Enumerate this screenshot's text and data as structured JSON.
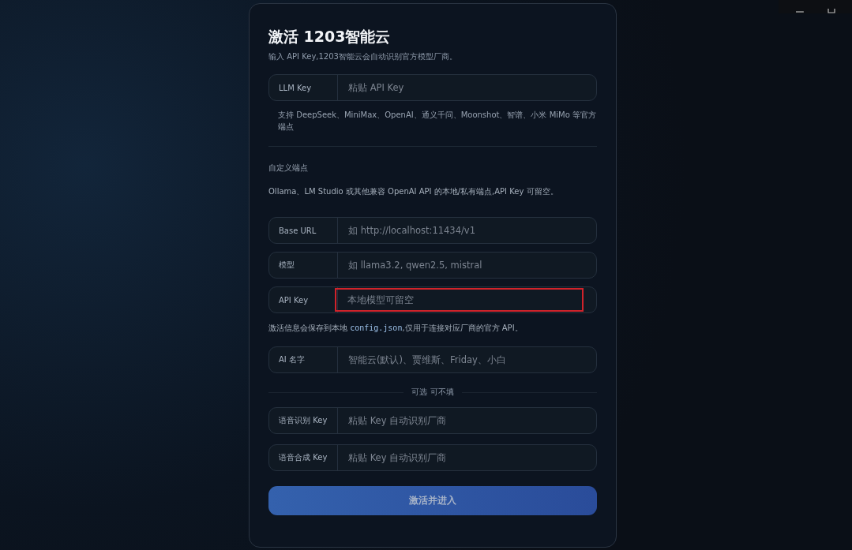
{
  "title": "激活 1203智能云",
  "subtitle": "输入 API Key,1203智能云会自动识别官方模型厂商。",
  "llm_field": {
    "label": "LLM Key",
    "placeholder": "粘贴 API Key",
    "highlighted": false
  },
  "llm_hint": "支持 DeepSeek、MiniMax、OpenAI、通义千问、Moonshot、智谱、小米 MiMo 等官方端点",
  "custom_section": {
    "heading": "自定义端点",
    "description": "Ollama、LM Studio 或其他兼容 OpenAI API 的本地/私有端点,API Key 可留空。",
    "fields": [
      {
        "label": "Base URL",
        "placeholder": "如 http://localhost:11434/v1",
        "highlighted": false
      },
      {
        "label": "模型",
        "placeholder": "如 llama3.2, qwen2.5, mistral",
        "highlighted": false
      },
      {
        "label": "API Key",
        "placeholder": "本地模型可留空",
        "highlighted": true
      }
    ]
  },
  "storage_note": {
    "before": "激活信息会保存到本地",
    "code": "config.json",
    "after": ",仅用于连接对应厂商的官方 API。"
  },
  "name_field": {
    "label": "AI 名字",
    "placeholder": "智能云(默认)、贾维斯、Friday、小白",
    "highlighted": false
  },
  "optional_divider": "可选 可不填",
  "voice_fields": [
    {
      "label": "语音识别 Key",
      "placeholder": "粘贴 Key 自动识别厂商",
      "highlighted": false
    },
    {
      "label": "语音合成 Key",
      "placeholder": "粘贴 Key 自动识别厂商",
      "highlighted": false
    }
  ],
  "submit_button": "激活并进入"
}
